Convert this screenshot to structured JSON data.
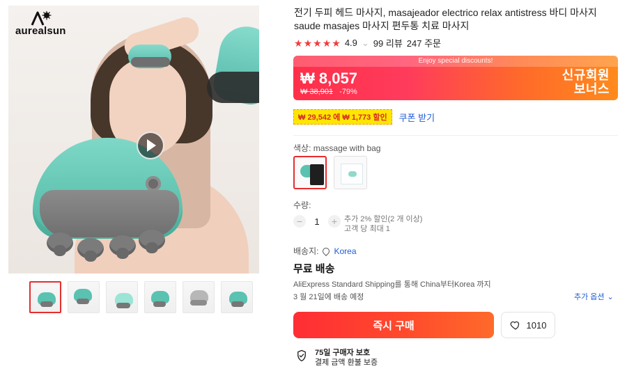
{
  "brand": {
    "name": "aurealsun"
  },
  "product": {
    "title": "전기 두피 헤드 마사지, masajeador electrico relax antistress 바디 마사지 saude masajes 마사지 편두통 치료 마사지",
    "rating_value": "4.9",
    "reviews_text": "99 리뷰",
    "orders_text": "247 주문"
  },
  "deal": {
    "banner_text": "Enjoy special discounts!",
    "price": "₩ 8,057",
    "old_price": "₩ 38,901",
    "discount": "-79%",
    "badge_line1": "신규회원",
    "badge_line2": "보너스"
  },
  "coupon": {
    "label": "₩ 29,542 에 ₩ 1,773 할인",
    "action": "쿠폰 받기"
  },
  "options": {
    "color_label": "색상: massage with bag",
    "quantity_label": "수량:",
    "quantity_value": "1",
    "quantity_note_1": "추가 2% 할인(2 개 이상)",
    "quantity_note_2": "고객 당 최대 1"
  },
  "shipping": {
    "to_label": "배송지:",
    "country": "Korea",
    "free_title": "무료 배송",
    "method": "AliExpress Standard Shipping를 통해 China부터Korea 까지",
    "eta": "3 월 21일에 배송 예정",
    "more_options": "추가 옵션"
  },
  "actions": {
    "buy_now": "즉시 구매",
    "wishlist_count": "1010"
  },
  "protection": {
    "title": "75일 구매자 보호",
    "subtitle": "결제 금액 환불 보증"
  },
  "ui": {
    "accent_red": "#e62e2e",
    "accent_orange": "#ff6a2a",
    "link_blue": "#1f5bd7"
  }
}
